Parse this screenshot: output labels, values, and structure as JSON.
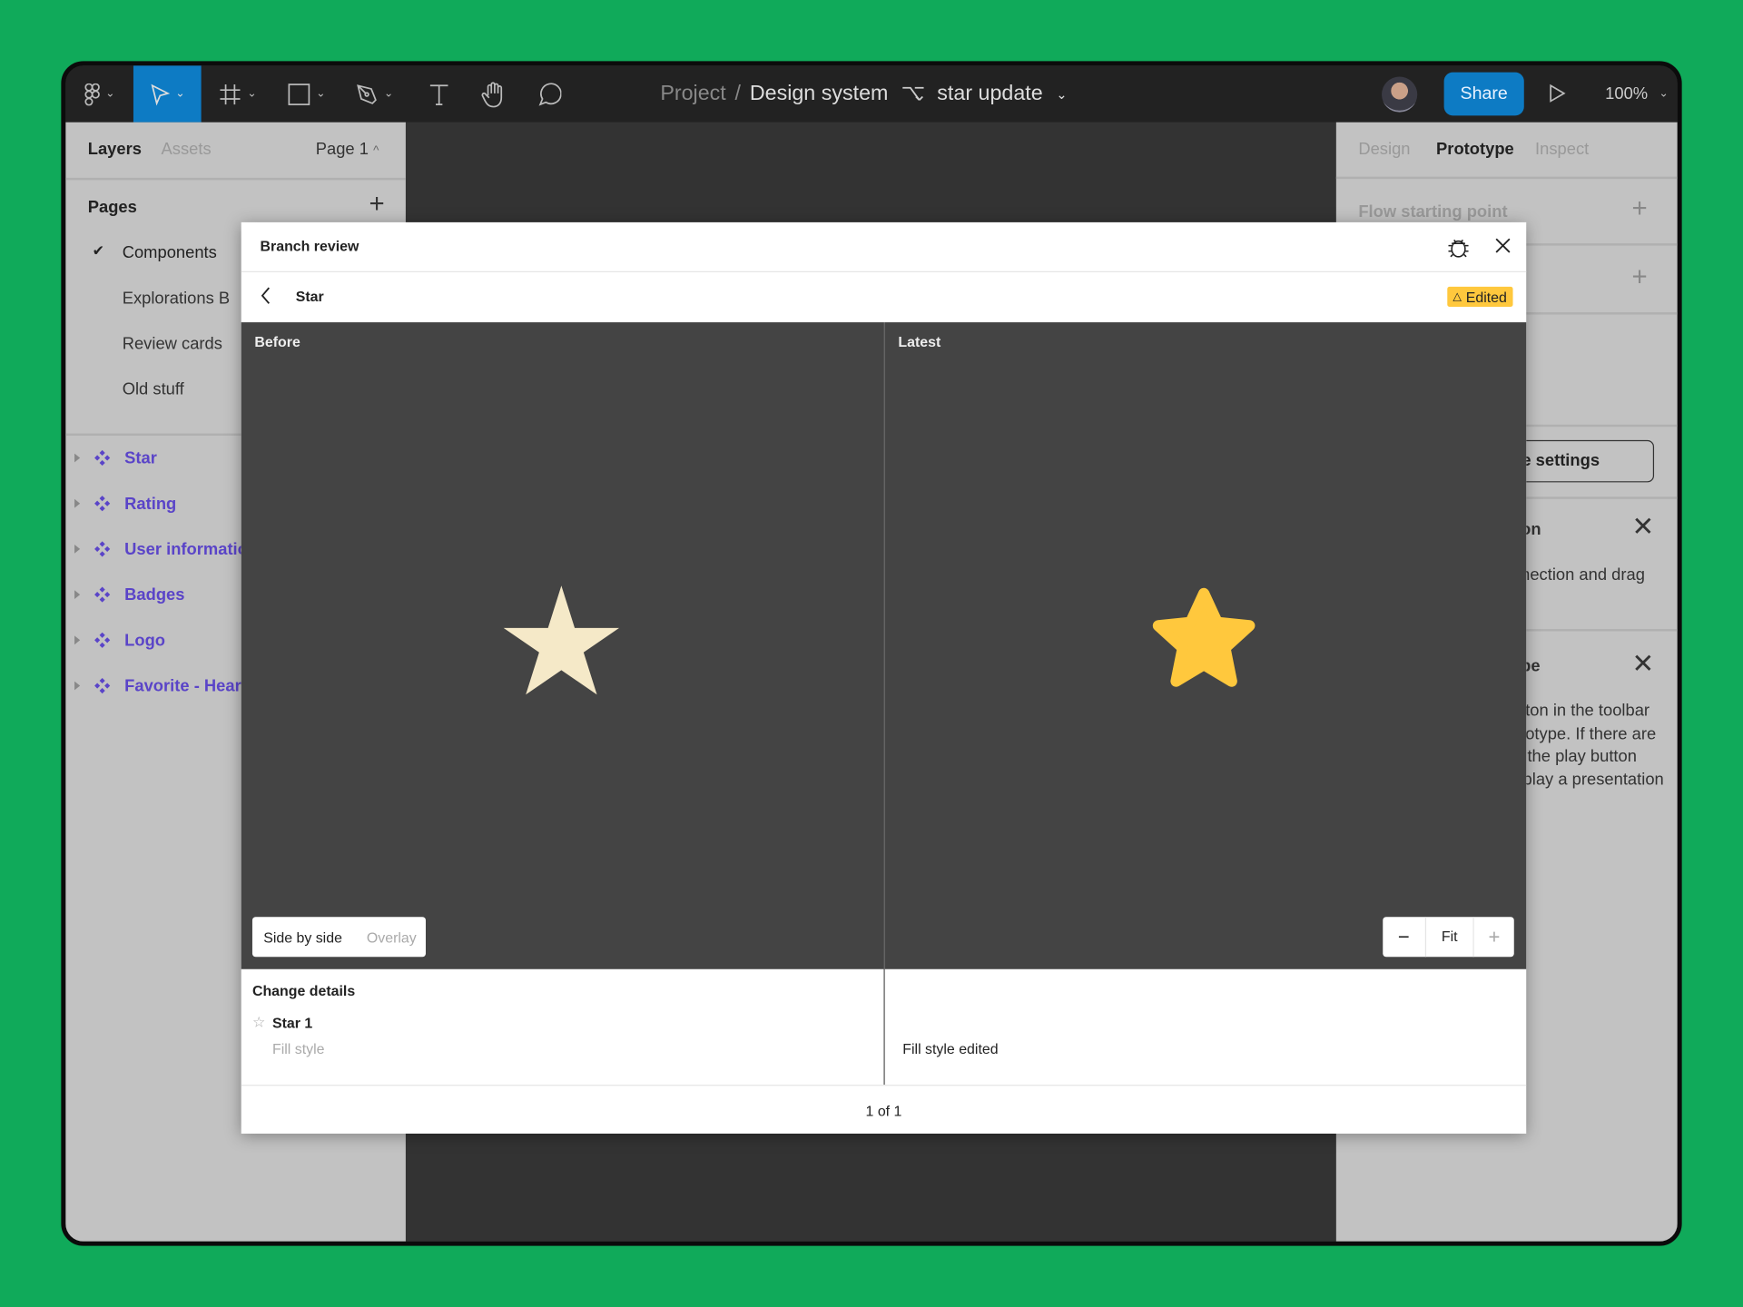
{
  "toolbar": {
    "tools": [
      "figma-menu",
      "move",
      "frame",
      "rectangle",
      "pen",
      "text",
      "hand",
      "comment"
    ],
    "breadcrumb": {
      "project": "Project",
      "separator": "/",
      "file": "Design system",
      "branch": "star update"
    },
    "share_label": "Share",
    "zoom": "100%",
    "accent": "#0d7bc4"
  },
  "left_panel": {
    "tabs": [
      "Layers",
      "Assets"
    ],
    "page_selector": "Page 1",
    "pages_heading": "Pages",
    "pages": [
      {
        "label": "Components",
        "selected": true
      },
      {
        "label": "Explorations B",
        "selected": false
      },
      {
        "label": "Review cards",
        "selected": false
      },
      {
        "label": "Old stuff",
        "selected": false
      }
    ],
    "layers": [
      "Star",
      "Rating",
      "User informatio",
      "Badges",
      "Logo",
      "Favorite - Hear"
    ],
    "layer_color": "#5a44c8"
  },
  "right_panel": {
    "tabs": [
      "Design",
      "Prototype",
      "Inspect"
    ],
    "active_tab": "Prototype",
    "flow_starting_point": "Flow starting point",
    "settings_button": "e settings",
    "section1_title": "on",
    "section1_text": "nection and drag",
    "section2_title": "pe",
    "section2_lines": [
      "tton in the toolbar",
      "totype. If there are",
      "the play button",
      "play a presentation"
    ]
  },
  "modal": {
    "title": "Branch review",
    "item_name": "Star",
    "status_badge": "Edited",
    "badge_color": "#ffc83d",
    "before_label": "Before",
    "latest_label": "Latest",
    "before_star_color": "#f5e9c8",
    "latest_star_color": "#ffc83d",
    "view_modes": [
      "Side by side",
      "Overlay"
    ],
    "active_view": "Side by side",
    "zoom_controls": {
      "minus": "−",
      "fit": "Fit",
      "plus": "+"
    },
    "change_details_heading": "Change details",
    "changed_layer": "Star 1",
    "changed_property": "Fill style",
    "change_description": "Fill style edited",
    "pager": "1 of 1"
  }
}
